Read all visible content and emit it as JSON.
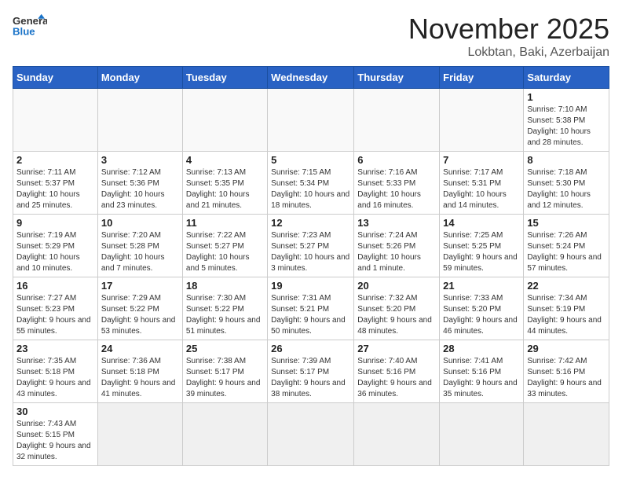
{
  "header": {
    "logo_general": "General",
    "logo_blue": "Blue",
    "month_title": "November 2025",
    "location": "Lokbtan, Baki, Azerbaijan"
  },
  "days_of_week": [
    "Sunday",
    "Monday",
    "Tuesday",
    "Wednesday",
    "Thursday",
    "Friday",
    "Saturday"
  ],
  "weeks": [
    [
      {
        "day": "",
        "info": ""
      },
      {
        "day": "",
        "info": ""
      },
      {
        "day": "",
        "info": ""
      },
      {
        "day": "",
        "info": ""
      },
      {
        "day": "",
        "info": ""
      },
      {
        "day": "",
        "info": ""
      },
      {
        "day": "1",
        "info": "Sunrise: 7:10 AM\nSunset: 5:38 PM\nDaylight: 10 hours and 28 minutes."
      }
    ],
    [
      {
        "day": "2",
        "info": "Sunrise: 7:11 AM\nSunset: 5:37 PM\nDaylight: 10 hours and 25 minutes."
      },
      {
        "day": "3",
        "info": "Sunrise: 7:12 AM\nSunset: 5:36 PM\nDaylight: 10 hours and 23 minutes."
      },
      {
        "day": "4",
        "info": "Sunrise: 7:13 AM\nSunset: 5:35 PM\nDaylight: 10 hours and 21 minutes."
      },
      {
        "day": "5",
        "info": "Sunrise: 7:15 AM\nSunset: 5:34 PM\nDaylight: 10 hours and 18 minutes."
      },
      {
        "day": "6",
        "info": "Sunrise: 7:16 AM\nSunset: 5:33 PM\nDaylight: 10 hours and 16 minutes."
      },
      {
        "day": "7",
        "info": "Sunrise: 7:17 AM\nSunset: 5:31 PM\nDaylight: 10 hours and 14 minutes."
      },
      {
        "day": "8",
        "info": "Sunrise: 7:18 AM\nSunset: 5:30 PM\nDaylight: 10 hours and 12 minutes."
      }
    ],
    [
      {
        "day": "9",
        "info": "Sunrise: 7:19 AM\nSunset: 5:29 PM\nDaylight: 10 hours and 10 minutes."
      },
      {
        "day": "10",
        "info": "Sunrise: 7:20 AM\nSunset: 5:28 PM\nDaylight: 10 hours and 7 minutes."
      },
      {
        "day": "11",
        "info": "Sunrise: 7:22 AM\nSunset: 5:27 PM\nDaylight: 10 hours and 5 minutes."
      },
      {
        "day": "12",
        "info": "Sunrise: 7:23 AM\nSunset: 5:27 PM\nDaylight: 10 hours and 3 minutes."
      },
      {
        "day": "13",
        "info": "Sunrise: 7:24 AM\nSunset: 5:26 PM\nDaylight: 10 hours and 1 minute."
      },
      {
        "day": "14",
        "info": "Sunrise: 7:25 AM\nSunset: 5:25 PM\nDaylight: 9 hours and 59 minutes."
      },
      {
        "day": "15",
        "info": "Sunrise: 7:26 AM\nSunset: 5:24 PM\nDaylight: 9 hours and 57 minutes."
      }
    ],
    [
      {
        "day": "16",
        "info": "Sunrise: 7:27 AM\nSunset: 5:23 PM\nDaylight: 9 hours and 55 minutes."
      },
      {
        "day": "17",
        "info": "Sunrise: 7:29 AM\nSunset: 5:22 PM\nDaylight: 9 hours and 53 minutes."
      },
      {
        "day": "18",
        "info": "Sunrise: 7:30 AM\nSunset: 5:22 PM\nDaylight: 9 hours and 51 minutes."
      },
      {
        "day": "19",
        "info": "Sunrise: 7:31 AM\nSunset: 5:21 PM\nDaylight: 9 hours and 50 minutes."
      },
      {
        "day": "20",
        "info": "Sunrise: 7:32 AM\nSunset: 5:20 PM\nDaylight: 9 hours and 48 minutes."
      },
      {
        "day": "21",
        "info": "Sunrise: 7:33 AM\nSunset: 5:20 PM\nDaylight: 9 hours and 46 minutes."
      },
      {
        "day": "22",
        "info": "Sunrise: 7:34 AM\nSunset: 5:19 PM\nDaylight: 9 hours and 44 minutes."
      }
    ],
    [
      {
        "day": "23",
        "info": "Sunrise: 7:35 AM\nSunset: 5:18 PM\nDaylight: 9 hours and 43 minutes."
      },
      {
        "day": "24",
        "info": "Sunrise: 7:36 AM\nSunset: 5:18 PM\nDaylight: 9 hours and 41 minutes."
      },
      {
        "day": "25",
        "info": "Sunrise: 7:38 AM\nSunset: 5:17 PM\nDaylight: 9 hours and 39 minutes."
      },
      {
        "day": "26",
        "info": "Sunrise: 7:39 AM\nSunset: 5:17 PM\nDaylight: 9 hours and 38 minutes."
      },
      {
        "day": "27",
        "info": "Sunrise: 7:40 AM\nSunset: 5:16 PM\nDaylight: 9 hours and 36 minutes."
      },
      {
        "day": "28",
        "info": "Sunrise: 7:41 AM\nSunset: 5:16 PM\nDaylight: 9 hours and 35 minutes."
      },
      {
        "day": "29",
        "info": "Sunrise: 7:42 AM\nSunset: 5:16 PM\nDaylight: 9 hours and 33 minutes."
      }
    ],
    [
      {
        "day": "30",
        "info": "Sunrise: 7:43 AM\nSunset: 5:15 PM\nDaylight: 9 hours and 32 minutes."
      },
      {
        "day": "",
        "info": ""
      },
      {
        "day": "",
        "info": ""
      },
      {
        "day": "",
        "info": ""
      },
      {
        "day": "",
        "info": ""
      },
      {
        "day": "",
        "info": ""
      },
      {
        "day": "",
        "info": ""
      }
    ]
  ]
}
